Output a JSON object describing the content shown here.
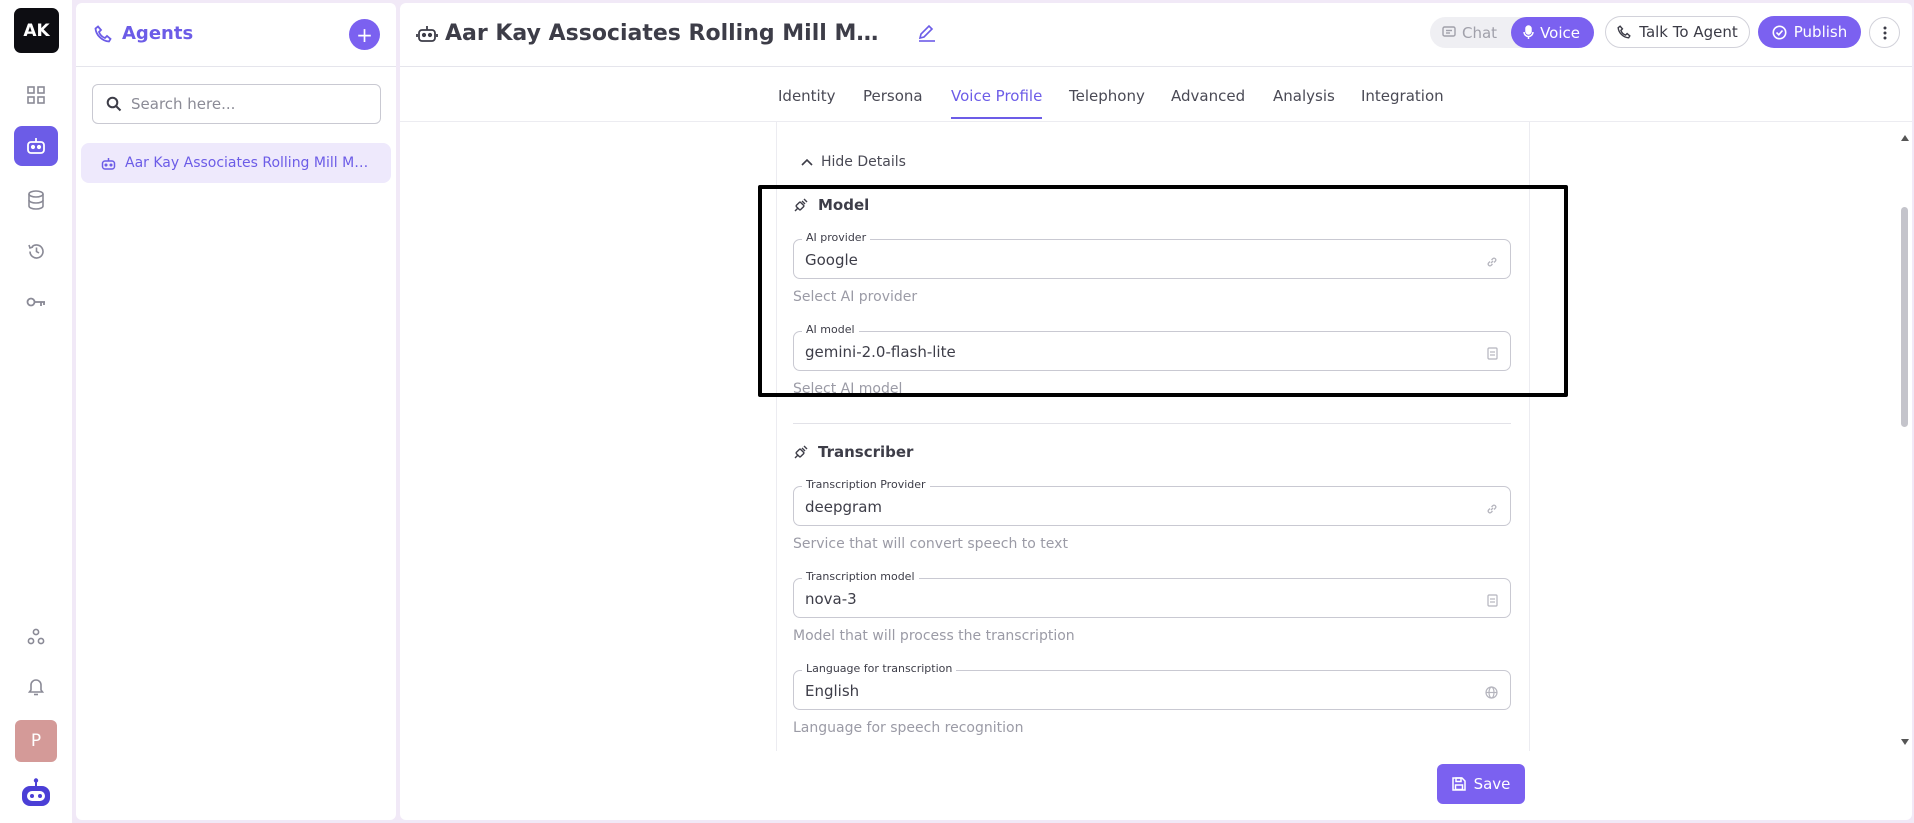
{
  "rail": {
    "logo_text": "AK",
    "nav": [
      "dashboard-icon",
      "agents-icon",
      "database-icon",
      "history-icon",
      "key-icon"
    ],
    "bottom": [
      "integrations-icon",
      "bell-icon"
    ],
    "avatar_text": "P"
  },
  "agents_panel": {
    "title": "Agents",
    "search_placeholder": "Search here...",
    "items": [
      {
        "label": "Aar Kay Associates Rolling Mill Machinery"
      }
    ]
  },
  "header": {
    "title": "Aar Kay Associates Rolling Mill Machinery",
    "chat_label": "Chat",
    "voice_label": "Voice",
    "talk_label": "Talk To Agent",
    "publish_label": "Publish"
  },
  "tabs": [
    "Identity",
    "Persona",
    "Voice Profile",
    "Telephony",
    "Advanced",
    "Analysis",
    "Integration"
  ],
  "active_tab": "Voice Profile",
  "content": {
    "hide_details": "Hide Details",
    "model": {
      "title": "Model",
      "provider_label": "AI provider",
      "provider_value": "Google",
      "provider_help": "Select AI provider",
      "model_label": "AI model",
      "model_value": "gemini-2.0-flash-lite",
      "model_help": "Select AI model"
    },
    "transcriber": {
      "title": "Transcriber",
      "provider_label": "Transcription Provider",
      "provider_value": "deepgram",
      "provider_help": "Service that will convert speech to text",
      "model_label": "Transcription model",
      "model_value": "nova-3",
      "model_help": "Model that will process the transcription",
      "lang_label": "Language for transcription",
      "lang_value": "English",
      "lang_help": "Language for speech recognition"
    }
  },
  "save_label": "Save",
  "colors": {
    "accent": "#7b61f0",
    "accent_text": "#6c5ce7",
    "bg": "#f1e9f7"
  }
}
